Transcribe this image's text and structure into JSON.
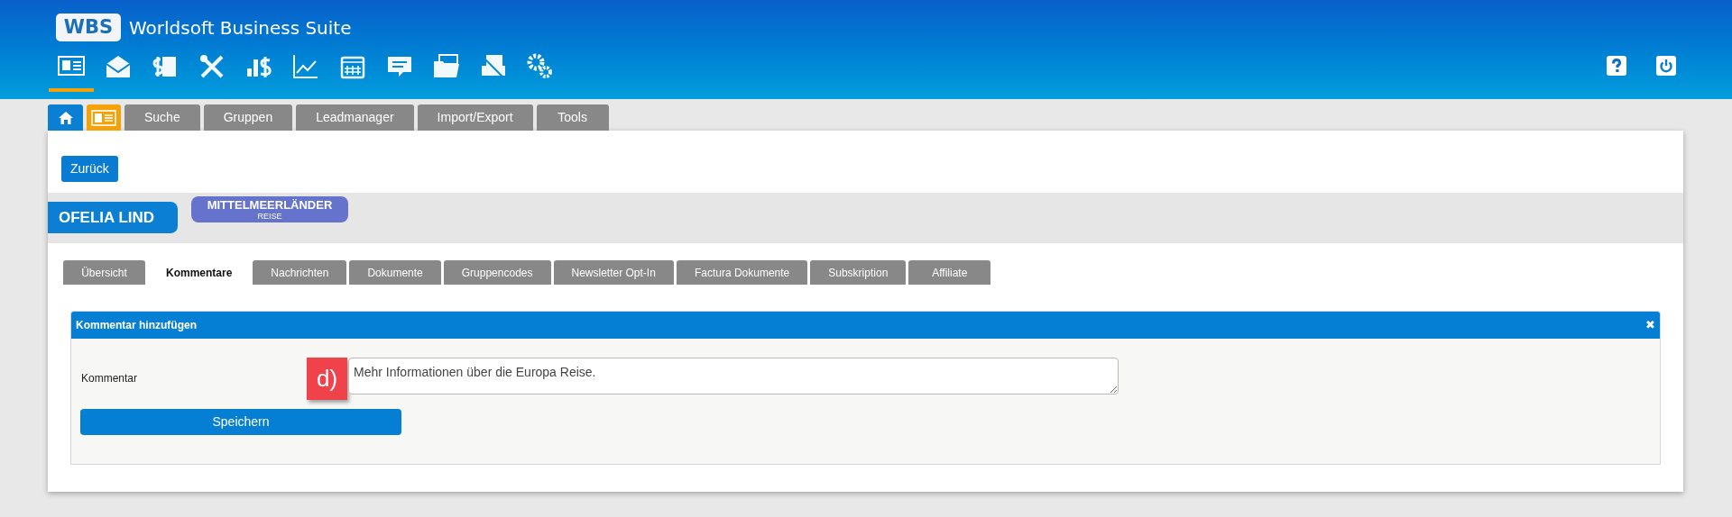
{
  "header": {
    "logo": "WBS",
    "title": "Worldsoft Business Suite",
    "app_icons": [
      {
        "selected": true
      },
      {
        "selected": false
      },
      {
        "selected": false
      },
      {
        "selected": false
      },
      {
        "selected": false
      },
      {
        "selected": false
      },
      {
        "selected": false
      },
      {
        "selected": false
      },
      {
        "selected": false
      },
      {
        "selected": false
      },
      {
        "selected": false
      }
    ]
  },
  "module_tabs": [
    {
      "kind": "home",
      "selected": false
    },
    {
      "kind": "card",
      "selected": true
    },
    {
      "kind": "text",
      "label": "Suche",
      "selected": false
    },
    {
      "kind": "text",
      "label": "Gruppen",
      "selected": false
    },
    {
      "kind": "text",
      "label": "Leadmanager",
      "selected": false
    },
    {
      "kind": "text",
      "label": "Import/Export",
      "selected": false
    },
    {
      "kind": "text",
      "label": "Tools",
      "selected": false
    }
  ],
  "back_button": "Zurück",
  "contact": {
    "name": "OFELIA LIND",
    "group": {
      "name": "MITTELMEERLÄNDER",
      "sub": "REISE"
    }
  },
  "tabs": [
    {
      "label": "Übersicht",
      "selected": false
    },
    {
      "label": "Kommentare",
      "selected": true
    },
    {
      "label": "Nachrichten",
      "selected": false
    },
    {
      "label": "Dokumente",
      "selected": false
    },
    {
      "label": "Gruppencodes",
      "selected": false
    },
    {
      "label": "Newsletter Opt-In",
      "selected": false
    },
    {
      "label": "Factura Dokumente",
      "selected": false
    },
    {
      "label": "Subskription",
      "selected": false
    },
    {
      "label": "Affiliate",
      "selected": false
    }
  ],
  "form": {
    "title": "Kommentar hinzufügen",
    "close": "✖",
    "label": "Kommentar",
    "annotation": "d)",
    "value": "Mehr Informationen über die Europa Reise.",
    "save": "Speichern"
  }
}
